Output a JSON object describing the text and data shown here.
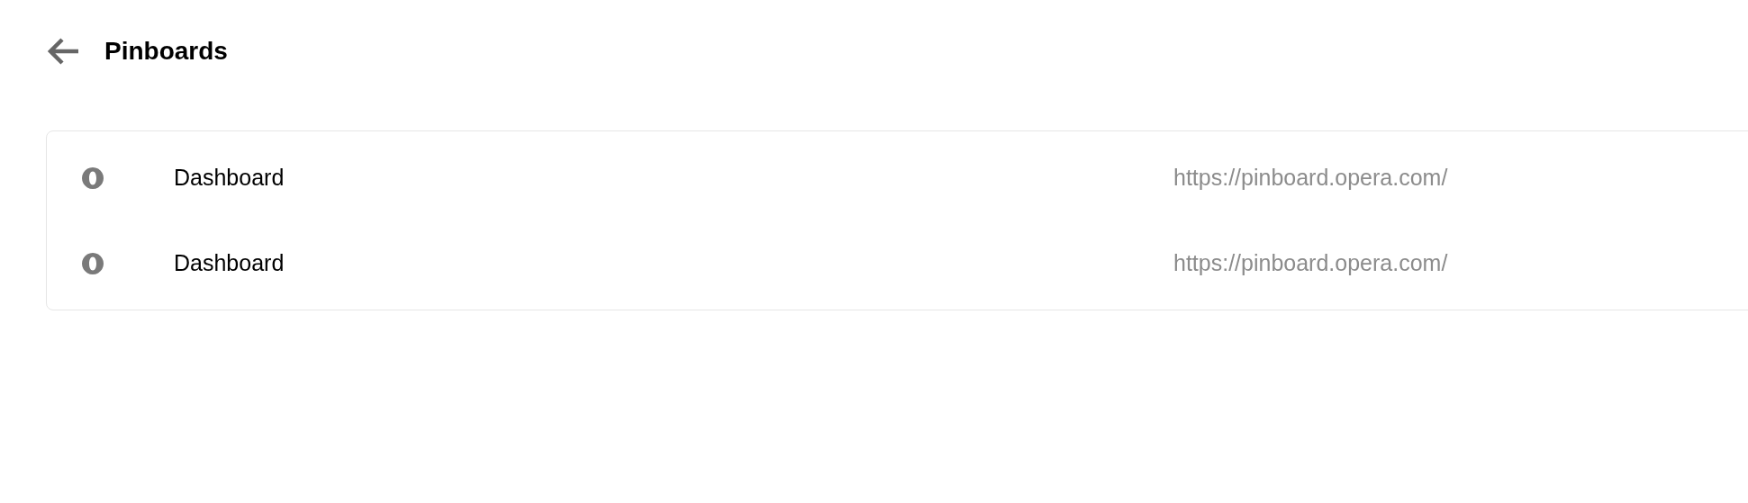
{
  "header": {
    "title": "Pinboards"
  },
  "pinboards": [
    {
      "name": "Dashboard",
      "url": "https://pinboard.opera.com/"
    },
    {
      "name": "Dashboard",
      "url": "https://pinboard.opera.com/"
    }
  ]
}
